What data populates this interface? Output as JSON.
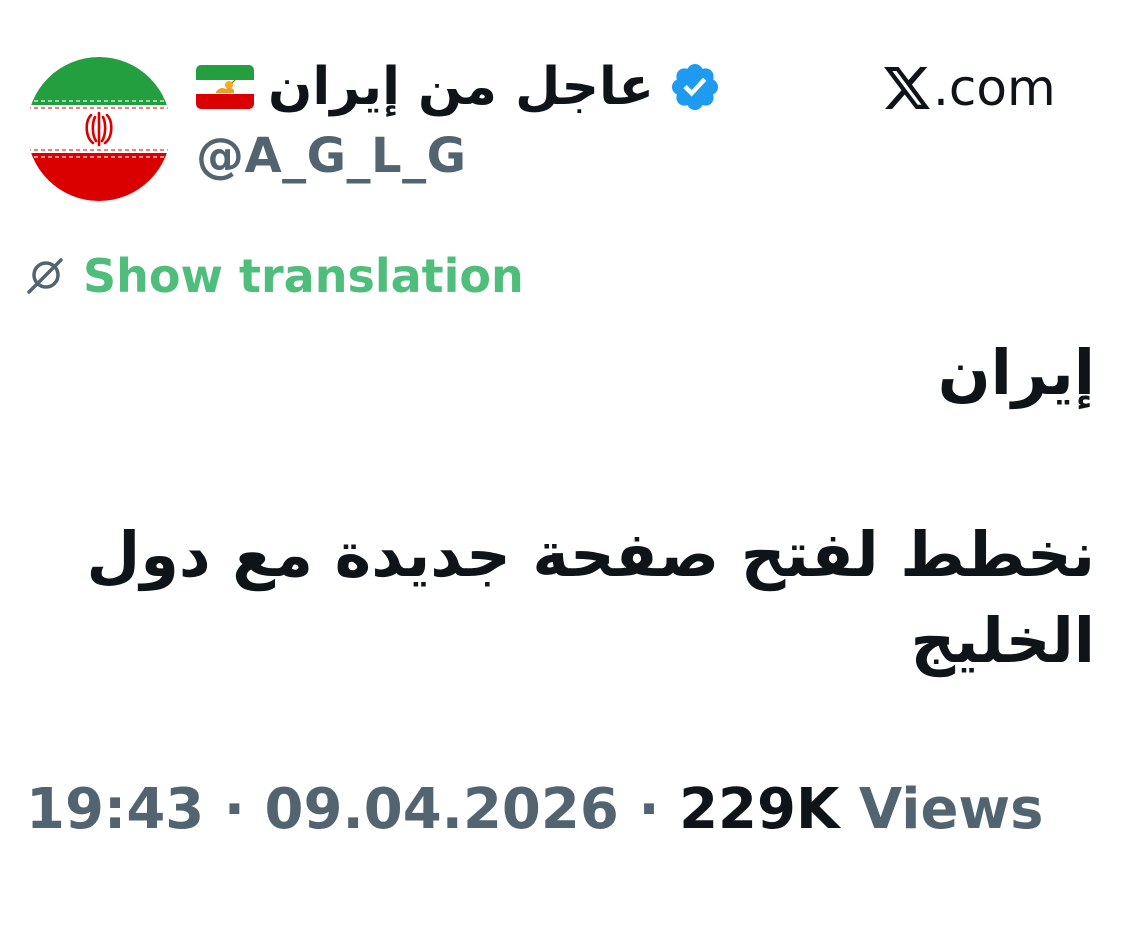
{
  "header": {
    "display_name": "عاجل من إيران",
    "handle": "@A_G_L_G",
    "verified": true,
    "name_flag_icon": "iran-lion-and-sun-flag-icon",
    "avatar_icon": "iran-flag-avatar",
    "brand": ".com",
    "brand_icon": "x-logo-icon"
  },
  "translate": {
    "icon": "translate-globe-icon",
    "label": "Show translation"
  },
  "tweet": {
    "line1": "إيران",
    "line2": "نخطط لفتح صفحة جديدة مع دول الخليج"
  },
  "meta": {
    "time": "19:43",
    "separator": "·",
    "date": "09.04.2026",
    "views_count": "229K",
    "views_label": "Views"
  },
  "colors": {
    "text": "#0f1419",
    "muted": "#536471",
    "translate_green": "#4fbd7c",
    "verified_blue": "#1d9bf0"
  }
}
